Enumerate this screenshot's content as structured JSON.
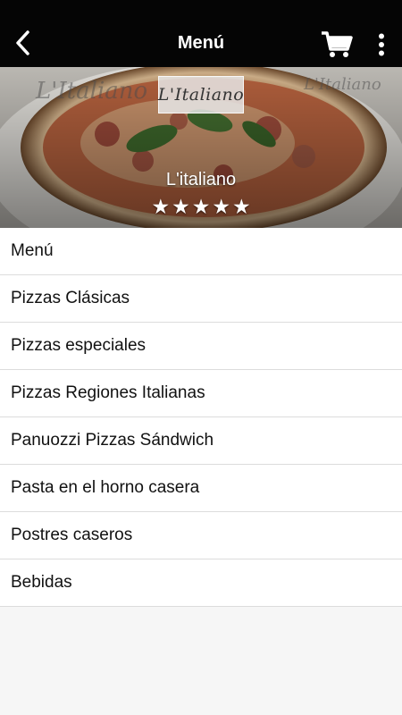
{
  "header": {
    "title": "Menú",
    "back_icon": "chevron-left-icon",
    "cart_icon": "cart-icon",
    "more_icon": "more-vertical-icon"
  },
  "hero": {
    "logo_text": "L'Italiano",
    "restaurant_name": "L'italiano",
    "rating": 5,
    "rating_max": 5
  },
  "menu": {
    "items": [
      {
        "label": "Menú"
      },
      {
        "label": "Pizzas Clásicas"
      },
      {
        "label": "Pizzas especiales"
      },
      {
        "label": "Pizzas Regiones Italianas"
      },
      {
        "label": "Panuozzi Pizzas Sándwich"
      },
      {
        "label": "Pasta en el horno casera"
      },
      {
        "label": "Postres caseros"
      },
      {
        "label": "Bebidas"
      }
    ]
  },
  "colors": {
    "header_bg": "#050505",
    "page_bg": "#f6f6f6",
    "divider": "#dcdcdc"
  }
}
